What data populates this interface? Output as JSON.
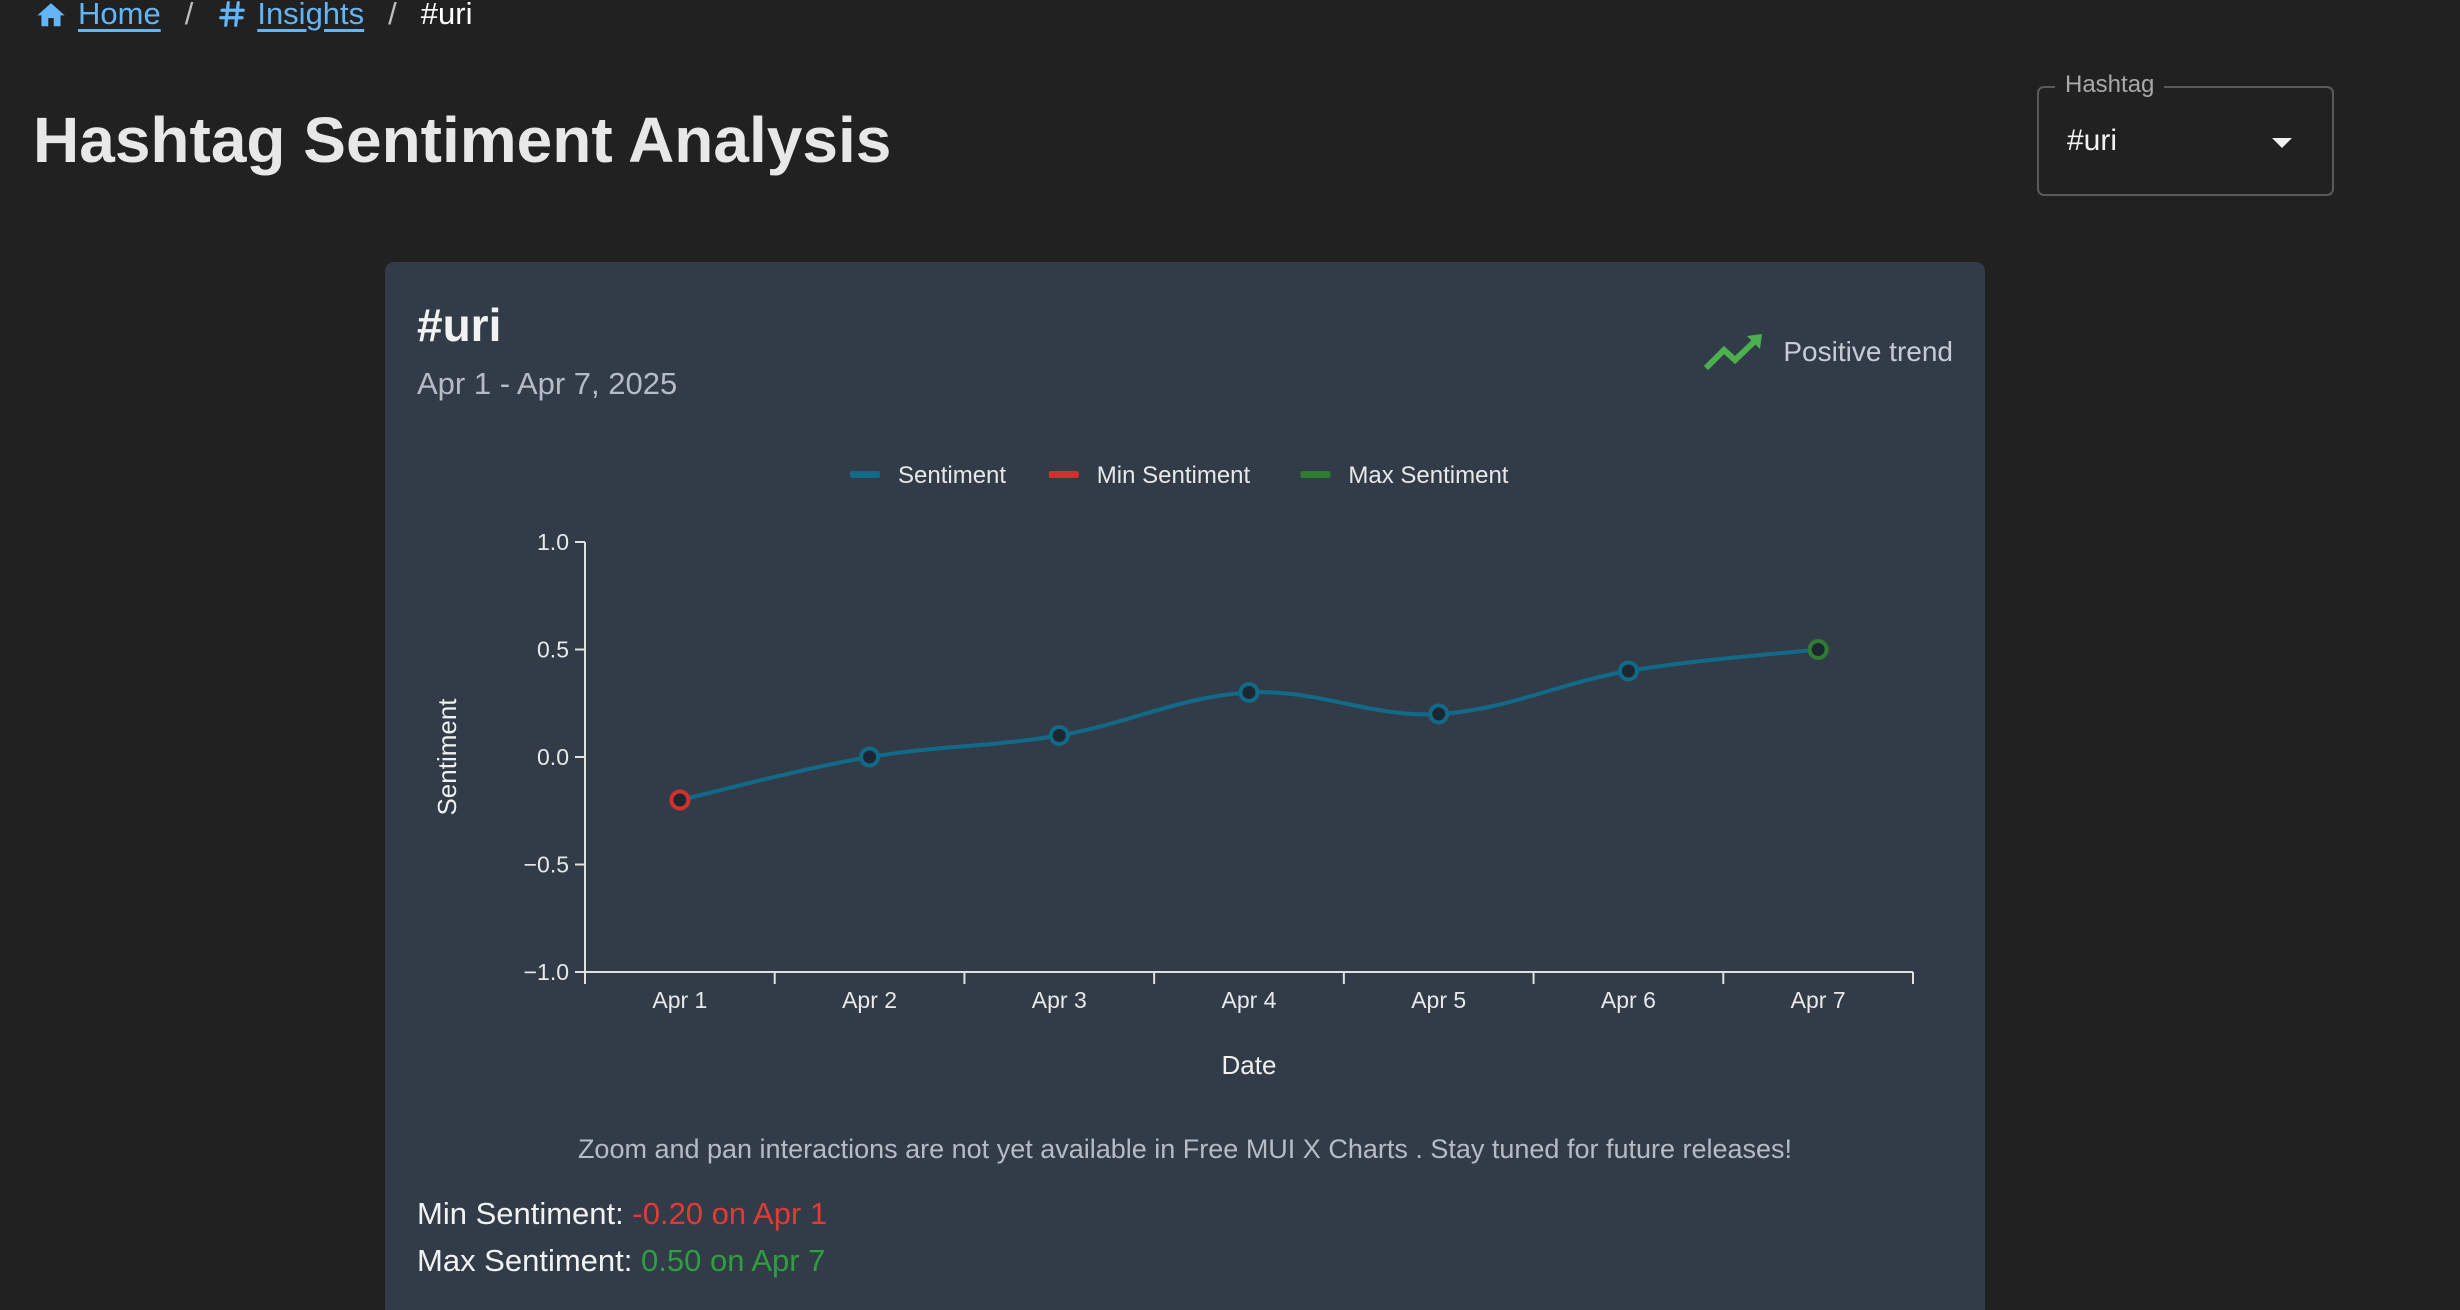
{
  "breadcrumb": {
    "home": "Home",
    "insights": "Insights",
    "current": "#uri",
    "separator": "/"
  },
  "page_title": "Hashtag Sentiment Analysis",
  "hashtag_select": {
    "label": "Hashtag",
    "value": "#uri"
  },
  "card": {
    "title": "#uri",
    "date_range": "Apr 1 - Apr 7, 2025",
    "trend_label": "Positive trend",
    "note": "Zoom and pan interactions are not yet available in Free MUI X Charts . Stay tuned for future releases!",
    "min_label": "Min Sentiment:",
    "min_value": "-0.20 on Apr 1",
    "max_label": "Max Sentiment:",
    "max_value": "0.50 on Apr 7"
  },
  "colors": {
    "accent_link": "#64b5f6",
    "sentiment_line": "#116a87",
    "min": "#e53935",
    "max": "#2e9e3e",
    "trend_icon": "#4caf50"
  },
  "chart_data": {
    "type": "line",
    "x": [
      "Apr 1",
      "Apr 2",
      "Apr 3",
      "Apr 4",
      "Apr 5",
      "Apr 6",
      "Apr 7"
    ],
    "series": [
      {
        "name": "Sentiment",
        "values": [
          -0.2,
          0.0,
          0.1,
          0.3,
          0.2,
          0.4,
          0.5
        ],
        "color": "#116a87"
      }
    ],
    "legend": [
      {
        "name": "Sentiment",
        "color": "#116a87"
      },
      {
        "name": "Min Sentiment",
        "color": "#d32f2f"
      },
      {
        "name": "Max Sentiment",
        "color": "#2e7d32"
      }
    ],
    "min_point": {
      "x": "Apr 1",
      "y": -0.2
    },
    "max_point": {
      "x": "Apr 7",
      "y": 0.5
    },
    "xlabel": "Date",
    "ylabel": "Sentiment",
    "ylim": [
      -1.0,
      1.0
    ],
    "yticks": [
      "1.0",
      "0.5",
      "0.0",
      "−0.5",
      "−1.0"
    ],
    "ytick_values": [
      1.0,
      0.5,
      0.0,
      -0.5,
      -1.0
    ],
    "grid": false,
    "legend_position": "top-center"
  }
}
